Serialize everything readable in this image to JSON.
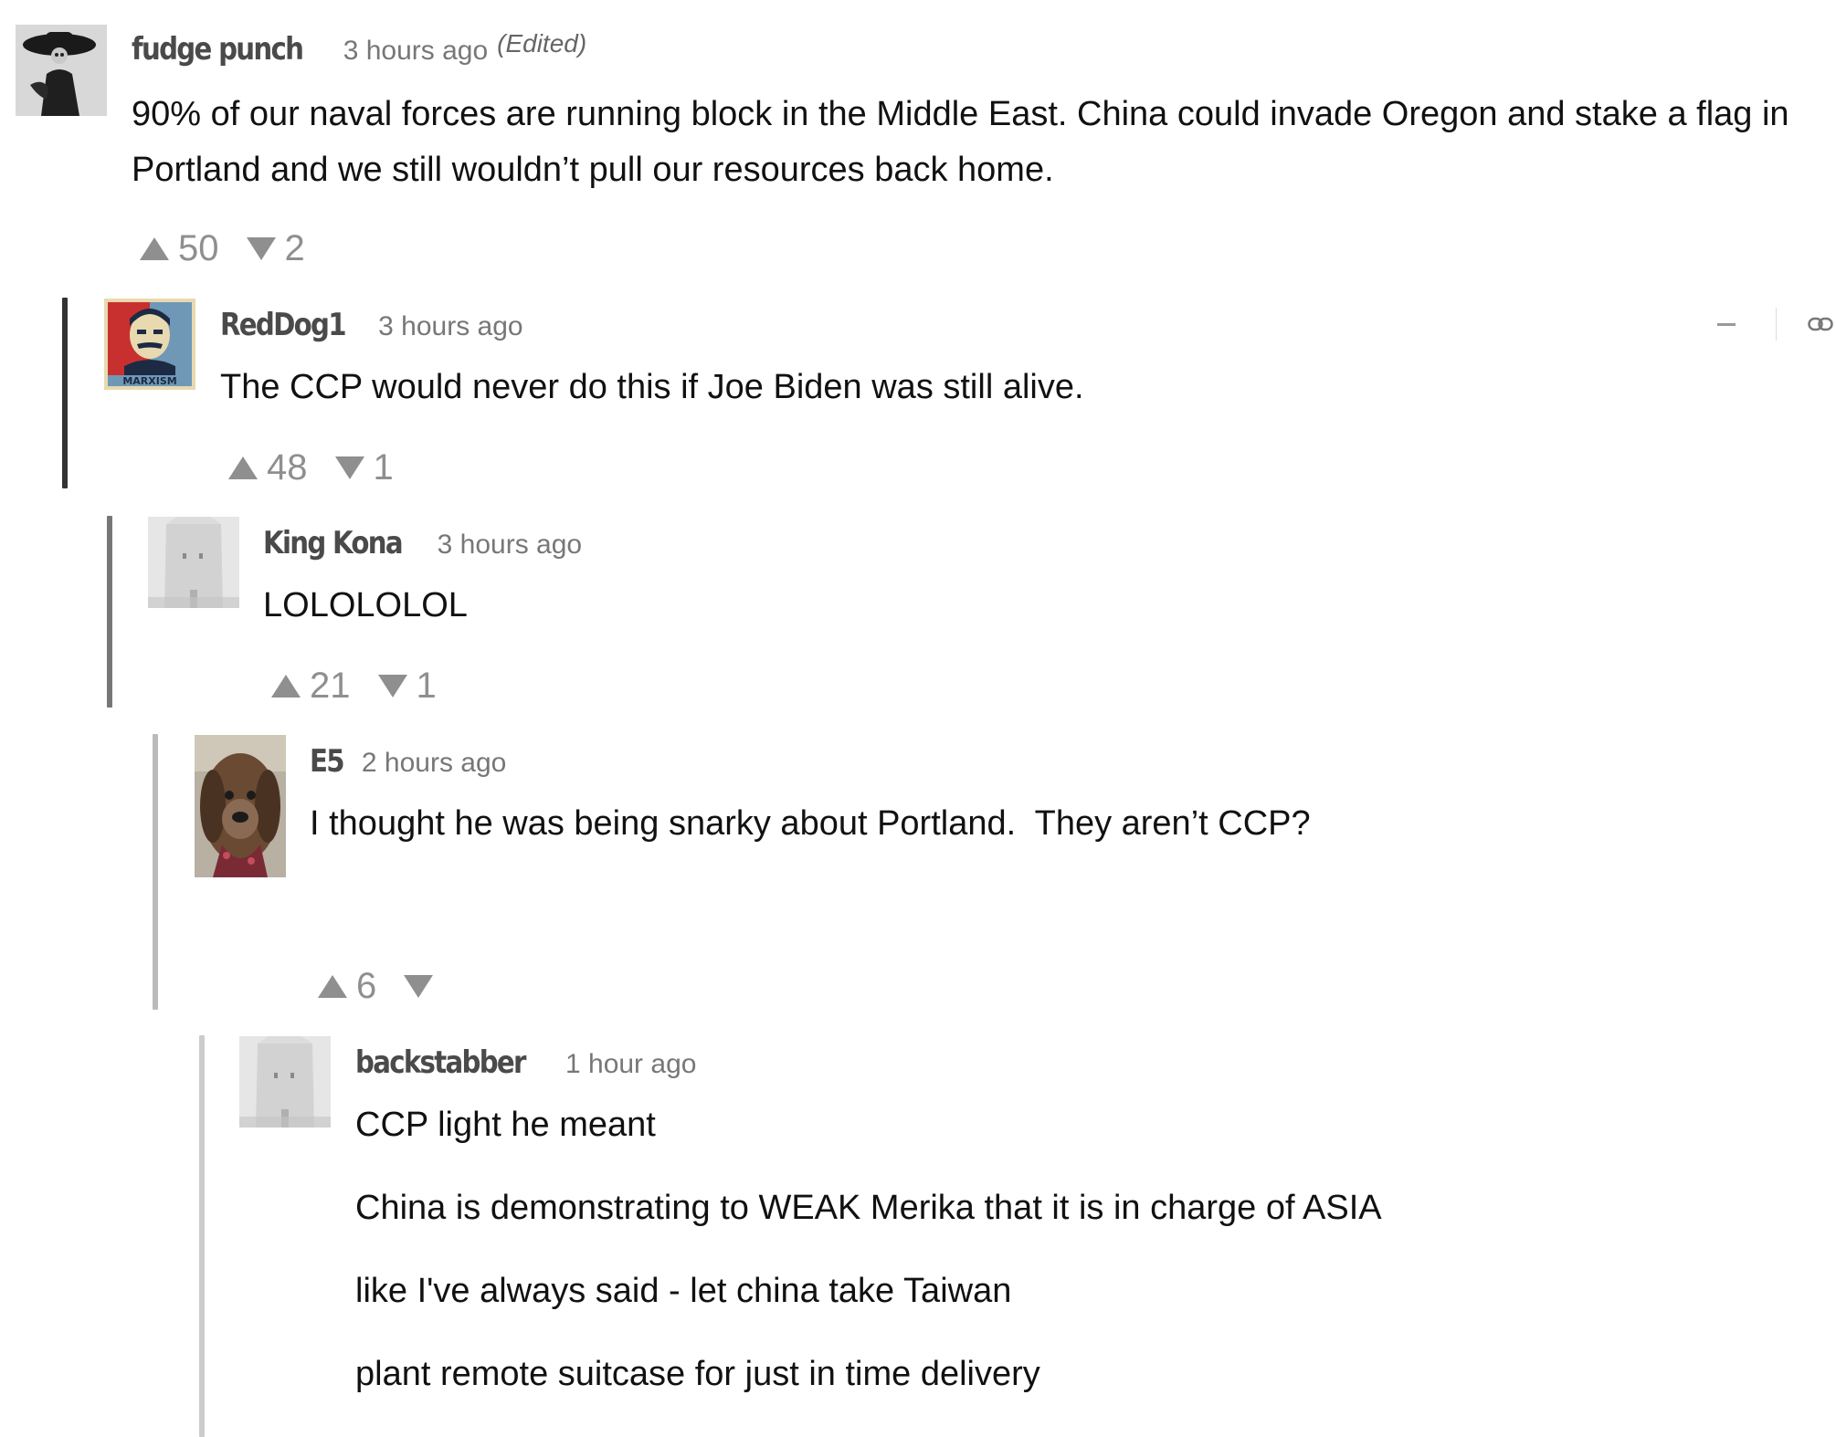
{
  "colors": {
    "thread_active": "#333333",
    "thread_mid": "#777777",
    "thread_light": "#bbbbbb",
    "thread_lighter": "#cccccc",
    "vote": "#8f8f8f",
    "author": "#4a4a4a",
    "timestamp": "#777777"
  },
  "comments": [
    {
      "author": "fudge punch",
      "time": "3 hours ago",
      "edited": "(Edited)",
      "avatar_icon": "sombrero-figure-avatar",
      "body": [
        "90% of our naval forces are running block in the Middle East. China could invade Oregon and stake a flag in Portland and we still wouldn’t pull our resources back home."
      ],
      "upvotes": "50",
      "downvotes": "2"
    },
    {
      "author": "RedDog1",
      "time": "3 hours ago",
      "avatar_icon": "marxism-poster-avatar",
      "avatar_text": "MARXISM",
      "body": [
        "The CCP would never do this if Joe Biden was still alive."
      ],
      "upvotes": "48",
      "downvotes": "1",
      "tools": {
        "collapse_icon": "minus-icon",
        "link_icon": "link-icon"
      }
    },
    {
      "author": "King Kona",
      "time": "3 hours ago",
      "avatar_icon": "paper-bag-avatar",
      "body": [
        "LOLOLOLOL"
      ],
      "upvotes": "21",
      "downvotes": "1"
    },
    {
      "author": "E5",
      "time": "2 hours ago",
      "avatar_icon": "dog-photo-avatar",
      "body": [
        "I thought he was being snarky about Portland.  They aren’t CCP?"
      ],
      "upvotes": "6",
      "downvotes": ""
    },
    {
      "author": "backstabber",
      "time": "1 hour ago",
      "avatar_icon": "paper-bag-avatar",
      "body": [
        "CCP light he meant",
        "China is demonstrating to WEAK Merika that it is in charge of ASIA",
        "like I've always said - let china take Taiwan",
        "plant remote suitcase for just in time delivery"
      ]
    }
  ]
}
